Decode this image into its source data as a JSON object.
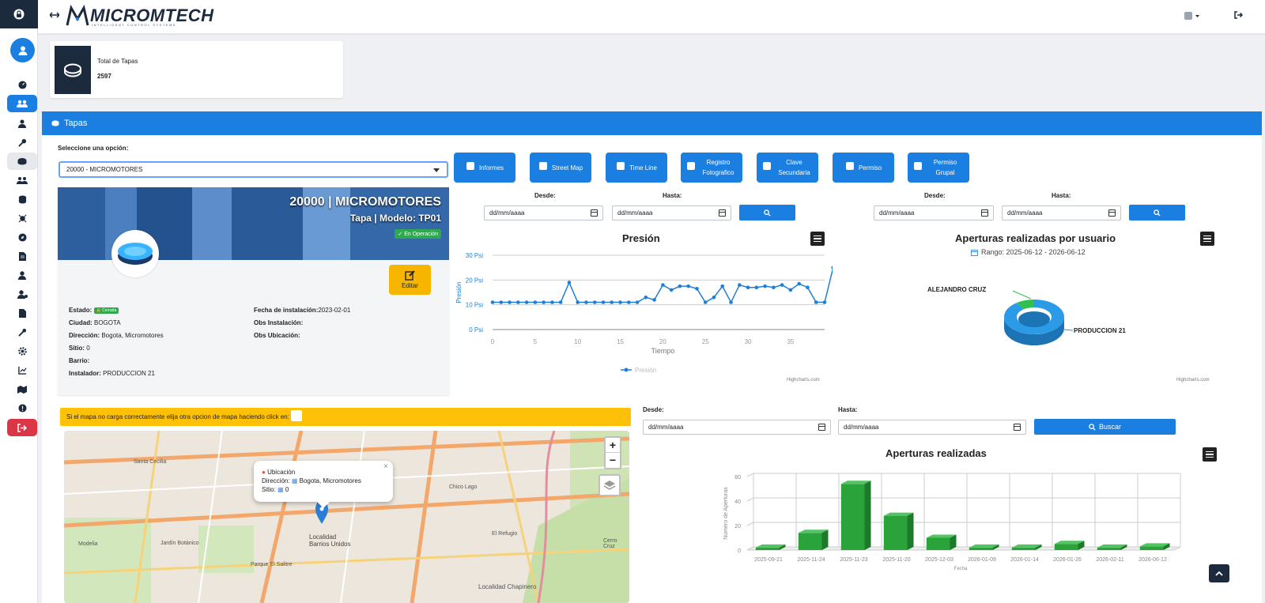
{
  "brand": {
    "name": "MICROMTECH",
    "tagline": "INTELLIGENT CONTROL SYSTEMS"
  },
  "stat_card": {
    "label": "Total de Tapas",
    "value": "2597"
  },
  "panel": {
    "title": "Tapas"
  },
  "select": {
    "label": "Seleccione una opción:",
    "value": "20000 - MICROMOTORES"
  },
  "device": {
    "title": "20000 | MICROMOTORES",
    "subtitle": "Tapa | Modelo: TP01",
    "status_badge": "En Operación",
    "edit_label": "Editar",
    "fields_left": [
      {
        "label": "Estado:",
        "value": "",
        "pill": "Cerrada"
      },
      {
        "label": "Ciudad:",
        "value": "BOGOTA"
      },
      {
        "label": "Dirección:",
        "value": "Bogota, Micromotores"
      },
      {
        "label": "Sitio:",
        "value": "0"
      },
      {
        "label": "Barrio:",
        "value": ""
      },
      {
        "label": "Instalador:",
        "value": "PRODUCCION 21"
      }
    ],
    "fields_right": [
      {
        "label": "Fecha de instalación:",
        "value": "2023-02-01"
      },
      {
        "label": "Obs Instalación:",
        "value": ""
      },
      {
        "label": "Obs Ubicación:",
        "value": ""
      }
    ]
  },
  "toolbar": {
    "buttons": [
      {
        "label": "Informes",
        "icon": "document-icon"
      },
      {
        "label": "Street Map",
        "icon": "map-icon"
      },
      {
        "label": "Time Line",
        "icon": "history-icon"
      },
      {
        "label": "Registro Fotografico",
        "icon": "camera-icon"
      },
      {
        "label": "Clave Secundaria",
        "icon": "lock-icon"
      },
      {
        "label": "Permiso",
        "icon": "user-check-icon"
      },
      {
        "label": "Permiso Grupal",
        "icon": "users-icon"
      }
    ]
  },
  "filters": {
    "desde": "Desde:",
    "hasta": "Hasta:",
    "date_placeholder": "dd/mm/aaaa",
    "buscar": "Buscar"
  },
  "credits": "Highcharts.com",
  "chart_data": [
    {
      "type": "line",
      "title": "Presión",
      "xlabel": "Tiempo",
      "ylabel": "Presión",
      "y_ticks": [
        "0 Psi",
        "10 Psi",
        "20 Psi",
        "30 Psi"
      ],
      "ylim": [
        0,
        30
      ],
      "x_ticks": [
        0,
        5,
        10,
        15,
        20,
        25,
        30,
        35
      ],
      "xlim": [
        0,
        39
      ],
      "series": [
        {
          "name": "Presión",
          "color": "#1f7fd6",
          "values": [
            11,
            11,
            11,
            11,
            11,
            11,
            11,
            11,
            11,
            19,
            11,
            11,
            11,
            11,
            11,
            11,
            11,
            11,
            13,
            12,
            18,
            16,
            17.5,
            17.5,
            16.5,
            11,
            13,
            17.5,
            11,
            18,
            17,
            17,
            17.5,
            17,
            18,
            16,
            18.5,
            17,
            11,
            11,
            25
          ]
        }
      ]
    },
    {
      "type": "pie",
      "title": "Aperturas realizadas por usuario",
      "subtitle": "Rango: 2025-06-12 - 2026-06-12",
      "slices": [
        {
          "name": "ALEJANDRO CRUZ",
          "value": 10,
          "color": "#2fc04e"
        },
        {
          "name": "PRODUCCION 21",
          "value": 90,
          "color": "#2b9be8"
        }
      ]
    },
    {
      "type": "bar",
      "title": "Aperturas realizadas",
      "xlabel": "Fecha",
      "ylabel": "Numero de Aperturas",
      "ylim": [
        0,
        60
      ],
      "y_ticks": [
        0,
        20,
        40,
        60
      ],
      "categories": [
        "2025-09-21",
        "2025-11-24",
        "2025-11-23",
        "2025-11-20",
        "2025-12-03",
        "2026-01-09",
        "2026-01-14",
        "2026-01-26",
        "2026-02-11",
        "2026-06-12"
      ],
      "series": [
        {
          "name": "Aperturas",
          "color": "#2aa43a",
          "values": [
            2,
            14,
            54,
            28,
            10,
            2,
            2,
            5,
            2,
            3
          ]
        }
      ]
    }
  ],
  "map": {
    "warning": "Si el mapa no carga correctamente elija otra opcion de mapa haciendo click en:",
    "zoom_in": "+",
    "zoom_out": "−",
    "popup": {
      "title": "Ubicación",
      "direccion_label": "Dirección:",
      "direccion": "Bogota, Micromotores",
      "sitio_label": "Sitio:",
      "sitio": "0",
      "close": "×"
    },
    "labels": [
      "Santa Cecilia",
      "Jardín Botánico",
      "Parque El Salitre",
      "Localidad Barrios Unidos",
      "Chico Lago",
      "El Refugio",
      "Modelia",
      "Localidad Chapinero",
      "Cerro Cruz"
    ]
  }
}
